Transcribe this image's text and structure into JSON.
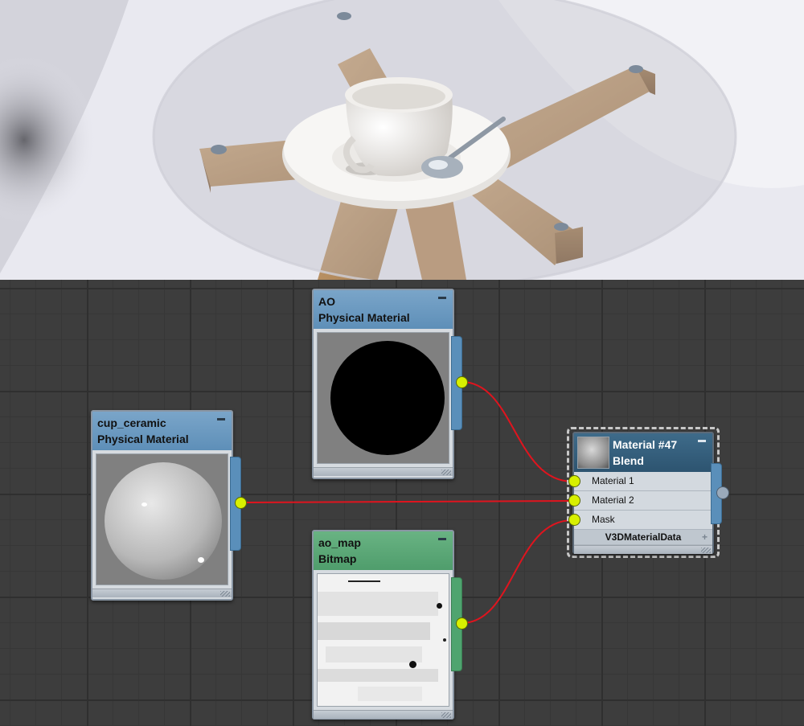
{
  "nodes": {
    "ao": {
      "name": "AO",
      "type": "Physical Material"
    },
    "cup": {
      "name": "cup_ceramic",
      "type": "Physical Material"
    },
    "bitmap": {
      "name": "ao_map",
      "type": "Bitmap"
    },
    "blend": {
      "name": "Material #47",
      "type": "Blend",
      "slots": [
        "Material 1",
        "Material 2",
        "Mask"
      ],
      "footer": "V3DMaterialData"
    }
  },
  "colors": {
    "wire": "#e0141e",
    "socket": "#d8f000",
    "header_blue": "#6a9bc3",
    "header_green": "#5aa877",
    "header_dark": "#345f7d"
  }
}
